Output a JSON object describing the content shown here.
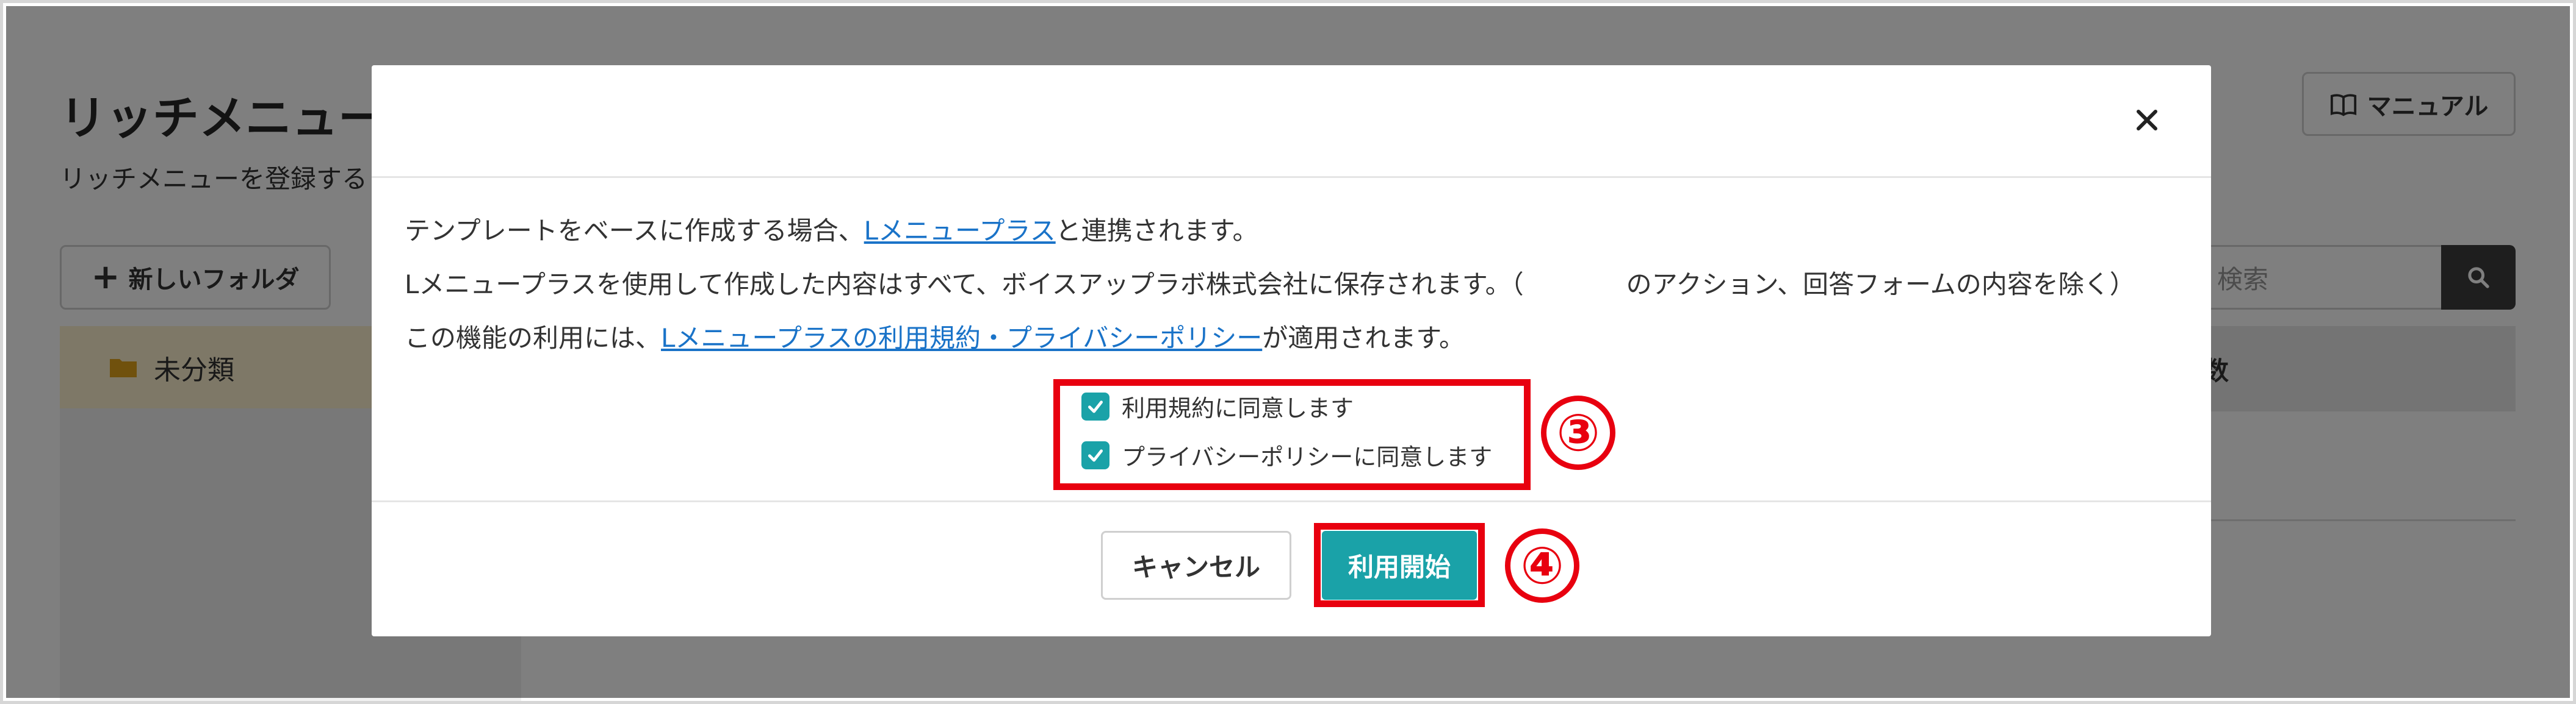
{
  "background": {
    "page_title": "リッチメニュー",
    "page_subtitle": "リッチメニューを登録する",
    "manual_label": "マニュアル",
    "new_folder_label": "新しいフォルダ",
    "folder_name": "未分類",
    "search_placeholder": "検索",
    "table_header_fragment": "数"
  },
  "modal": {
    "line1_prefix": "テンプレートをベースに作成する場合、",
    "line1_link": "Lメニュープラス",
    "line1_suffix": "と連携されます。",
    "line2": "Lメニュープラスを使用して作成した内容はすべて、ボイスアップラボ株式会社に保存されます。（　　　　のアクション、回答フォームの内容を除く）",
    "line3_prefix": "この機能の利用には、",
    "line3_link": "Lメニュープラスの利用規約・プライバシーポリシー",
    "line3_suffix": "が適用されます。",
    "checkbox_terms": "利用規約に同意します",
    "checkbox_privacy": "プライバシーポリシーに同意します",
    "cancel_label": "キャンセル",
    "start_label": "利用開始"
  },
  "annotations": {
    "step3": "③",
    "step4": "④",
    "highlight_color": "#e8000f"
  },
  "colors": {
    "accent": "#1aa2a8",
    "link": "#1a73c8",
    "folder_highlight": "#fdf1cf"
  },
  "icons": [
    "book-icon",
    "plus-icon",
    "folder-icon",
    "search-icon",
    "close-icon",
    "check-icon"
  ]
}
